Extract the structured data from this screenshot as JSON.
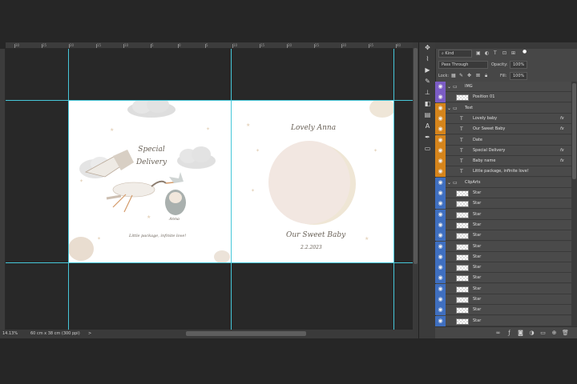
{
  "status": {
    "zoom": "14.13%",
    "doc_size": "60 cm x 38 cm (300 ppi)",
    "arrow": ">"
  },
  "ruler_ticks": [
    "30",
    "25",
    "20",
    "15",
    "10",
    "5",
    "0",
    "5",
    "10",
    "15",
    "20",
    "25",
    "30",
    "35",
    "40",
    "45",
    "50",
    "55",
    "60"
  ],
  "artwork": {
    "special_delivery": "Special Delivery",
    "baby_name_left": "Anna",
    "tagline": "Little package, infinite love!",
    "lovely_name": "Lovely Anna",
    "sweet_baby": "Our Sweet Baby",
    "date": "2.2.2023"
  },
  "layers_panel": {
    "filter_kind": "Kind",
    "blend_mode": "Pass Through",
    "opacity_label": "Opacity:",
    "opacity_value": "100%",
    "lock_label": "Lock:",
    "fill_label": "Fill:",
    "fill_value": "100%",
    "layers": [
      {
        "name": "IMG",
        "type": "group",
        "color": "#7b5cc4",
        "indent": 0
      },
      {
        "name": "Position 01",
        "type": "smart",
        "color": "#7b5cc4",
        "indent": 1
      },
      {
        "name": "Text",
        "type": "group",
        "color": "#d5841b",
        "indent": 0
      },
      {
        "name": "Lovely baby",
        "type": "text",
        "color": "#d5841b",
        "indent": 1,
        "fx": true
      },
      {
        "name": "Our Sweet Baby",
        "type": "text",
        "color": "#d5841b",
        "indent": 1,
        "fx": true
      },
      {
        "name": "Date",
        "type": "text",
        "color": "#d5841b",
        "indent": 1,
        "fx": false
      },
      {
        "name": "Special Delivery",
        "type": "text",
        "color": "#d5841b",
        "indent": 1,
        "fx": true
      },
      {
        "name": "Baby name",
        "type": "text",
        "color": "#d5841b",
        "indent": 1,
        "fx": true
      },
      {
        "name": "Little package, infinite love!",
        "type": "text",
        "color": "#d5841b",
        "indent": 1,
        "fx": false
      },
      {
        "name": "ClipArts",
        "type": "group",
        "color": "#3f6fc0",
        "indent": 0
      },
      {
        "name": "Star",
        "type": "pixel",
        "color": "#3f6fc0",
        "indent": 1
      },
      {
        "name": "Star",
        "type": "pixel",
        "color": "#3f6fc0",
        "indent": 1
      },
      {
        "name": "Star",
        "type": "pixel",
        "color": "#3f6fc0",
        "indent": 1
      },
      {
        "name": "Star",
        "type": "pixel",
        "color": "#3f6fc0",
        "indent": 1
      },
      {
        "name": "Star",
        "type": "pixel",
        "color": "#3f6fc0",
        "indent": 1
      },
      {
        "name": "Star",
        "type": "pixel",
        "color": "#3f6fc0",
        "indent": 1
      },
      {
        "name": "Star",
        "type": "pixel",
        "color": "#3f6fc0",
        "indent": 1
      },
      {
        "name": "Star",
        "type": "pixel",
        "color": "#3f6fc0",
        "indent": 1
      },
      {
        "name": "Star",
        "type": "pixel",
        "color": "#3f6fc0",
        "indent": 1
      },
      {
        "name": "Star",
        "type": "pixel",
        "color": "#3f6fc0",
        "indent": 1
      },
      {
        "name": "Star",
        "type": "pixel",
        "color": "#3f6fc0",
        "indent": 1
      },
      {
        "name": "Star",
        "type": "pixel",
        "color": "#3f6fc0",
        "indent": 1
      },
      {
        "name": "Star",
        "type": "pixel",
        "color": "#3f6fc0",
        "indent": 1
      },
      {
        "name": "Star",
        "type": "pixel",
        "color": "#3f6fc0",
        "indent": 1
      }
    ]
  },
  "tools": [
    "move-icon",
    "lasso-icon",
    "play-icon",
    "brush-icon",
    "stamp-icon",
    "eraser-icon",
    "gradient-icon",
    "type-icon",
    "pen-icon",
    "shape-icon"
  ],
  "footer_icons": [
    "link-icon",
    "fx-icon",
    "mask-icon",
    "adjustment-icon",
    "folder-icon",
    "new-layer-icon",
    "trash-icon"
  ]
}
